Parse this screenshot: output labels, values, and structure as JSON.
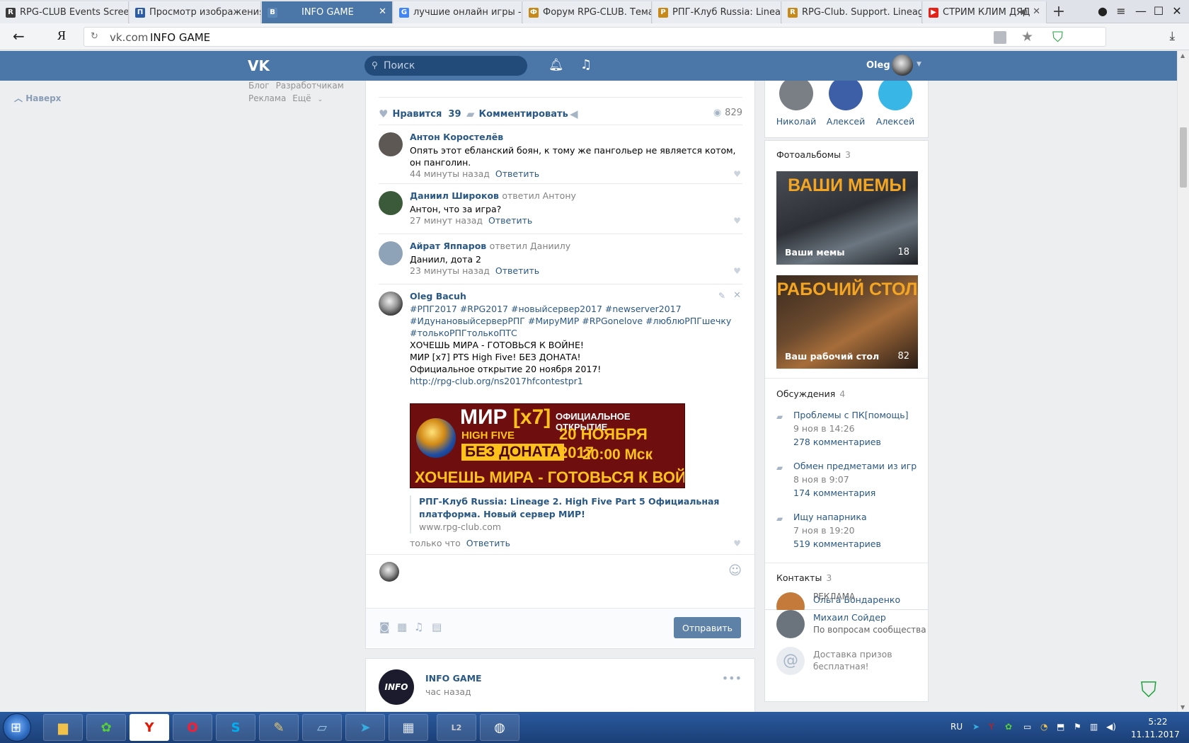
{
  "tabs": [
    {
      "label": "RPG-CLUB Events Screens",
      "color": "#3b3b3b",
      "glyph": "R"
    },
    {
      "label": "Просмотр изображения",
      "color": "#2c5ca8",
      "glyph": "П"
    },
    {
      "label": "INFO GAME",
      "color": "#4a76a8",
      "glyph": "В"
    },
    {
      "label": "лучшие онлайн игры - П",
      "color": "#4285f4",
      "glyph": "G"
    },
    {
      "label": "Форум RPG-CLUB. Тема:",
      "color": "#c78a1a",
      "glyph": "Ф"
    },
    {
      "label": "РПГ-Клуб Russia: Lineage",
      "color": "#c78a1a",
      "glyph": "Р"
    },
    {
      "label": "RPG-Club. Support. Lineag",
      "color": "#c78a1a",
      "glyph": "R"
    },
    {
      "label": "СТРИМ КЛИМ ДЯД",
      "color": "#e62117",
      "glyph": "▶"
    }
  ],
  "address": {
    "host": "vk.com",
    "title": "INFO GAME"
  },
  "vk": {
    "search_placeholder": "Поиск",
    "user_name": "Oleg",
    "up_label": "Наверх",
    "footer": {
      "blog": "Блог",
      "devs": "Разработчикам",
      "ads": "Реклама",
      "more": "Ещё"
    }
  },
  "post": {
    "like_label": "Нравится",
    "like_count": "39",
    "comment_label": "Комментировать",
    "views": "829",
    "comments": [
      {
        "author": "Антон Коростелёв",
        "reply_to": "",
        "text": "Опять этот ебланский боян, к тому же пангольер не является котом, он пангoлин.",
        "time": "44 минуты назад",
        "reply": "Ответить"
      },
      {
        "author": "Даниил Широков",
        "reply_to": "ответил Антону",
        "text": "Антон, что за игра?",
        "time": "27 минут назад",
        "reply": "Ответить"
      },
      {
        "author": "Айрат Яппаров",
        "reply_to": "ответил Даниилу",
        "text": "Даниил, дота 2",
        "time": "23 минуты назад",
        "reply": "Ответить"
      }
    ],
    "own_comment": {
      "author": "Oleg Bacuh",
      "lines": [
        "#РПГ2017 #RPG2017 #новыйсервер2017 #newserver2017",
        "#ИдунановыйсерверРПГ #МируМИР #RPGonelove #люблюРПГшечку",
        "#толькоРПГтолькоПТС",
        "ХОЧЕШЬ МИРА - ГОТОВЬСЯ К ВОЙНЕ!",
        "МИР [x7] PTS High Five! БЕЗ ДОНАТА!",
        "Официальное открытие 20 ноября 2017!"
      ],
      "link": "http://rpg-club.org/ns2017hfcontestpr1",
      "banner": {
        "mir": "МИР",
        "x7": "[x7]",
        "highfive": "HIGH FIVE",
        "nodonate": "БЕЗ ДОНАТА",
        "official": "ОФИЦИАЛЬНОЕ ОТКРЫТИЕ",
        "date": "20 НОЯБРЯ 2017",
        "time": "20:00 Мск",
        "slogan": "ХОЧЕШЬ МИРА - ГОТОВЬСЯ К ВОЙНЕ"
      },
      "snippet_title": "РПГ-Клуб Russia: Lineage 2. High Five Part 5 Официальная платформа. Новый сервер МИР!",
      "snippet_domain": "www.rpg-club.com",
      "time": "только что",
      "reply": "Ответить"
    },
    "send_label": "Отправить"
  },
  "post2": {
    "name": "INFO GAME",
    "avatar_text": "INFO",
    "time": "час назад"
  },
  "members": [
    {
      "name": "Николай",
      "color": "#7a7f86"
    },
    {
      "name": "Алексей",
      "color": "#3d5fa8"
    },
    {
      "name": "Алексей",
      "color": "#38b6e6"
    }
  ],
  "albums": {
    "title": "Фотоальбомы",
    "count": "3",
    "items": [
      {
        "heading": "ВАШИ МЕМЫ",
        "name": "Ваши мемы",
        "count": "18"
      },
      {
        "heading": "РАБОЧИЙ СТОЛ",
        "name": "Ваш рабочий стол",
        "count": "82"
      }
    ]
  },
  "discussions": {
    "title": "Обсуждения",
    "count": "4",
    "items": [
      {
        "title": "Проблемы с ПК[помощь]",
        "date": "9 ноя в 14:26",
        "comments": "278 комментариев"
      },
      {
        "title": "Обмен предметами из игр",
        "date": "8 ноя в 9:07",
        "comments": "174 комментария"
      },
      {
        "title": "Ищу напарника",
        "date": "7 ноя в 19:20",
        "comments": "519 комментариев"
      }
    ]
  },
  "contacts": {
    "title": "Контакты",
    "count": "3",
    "items": [
      {
        "name": "Ольга Бондаренко",
        "role": "РЕКЛАМА"
      },
      {
        "name": "Михаил Сойдер",
        "role": "По вопросам сообщества"
      },
      {
        "name": "Доставка призов",
        "role": "бесплатная!"
      }
    ]
  },
  "taskbar": {
    "apps": [
      "Explorer",
      "ICQ",
      "Yandex",
      "Opera",
      "Skype",
      "Paint",
      "Notepad",
      "Telegram",
      "Calculator",
      "Lineage II",
      "Game"
    ],
    "lang": "RU",
    "time": "5:22",
    "date": "11.11.2017"
  }
}
